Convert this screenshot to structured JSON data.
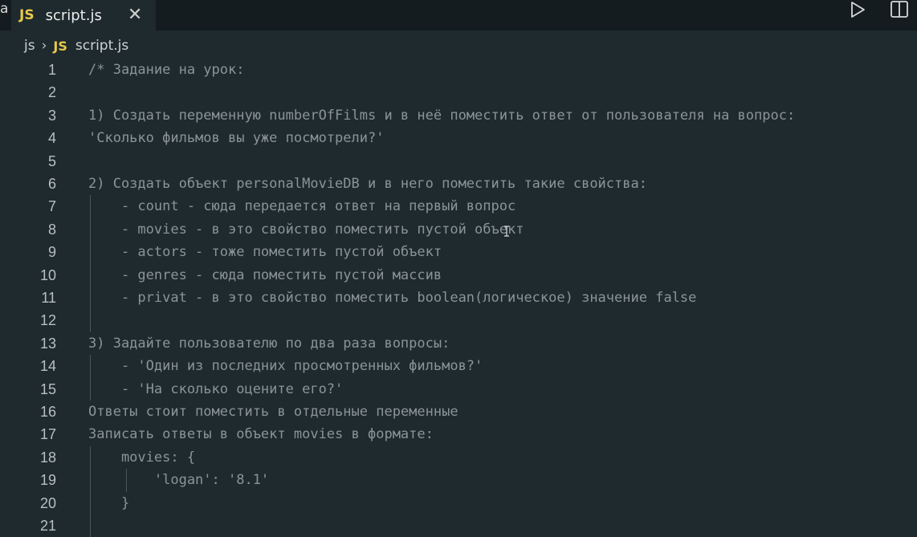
{
  "tabbar": {
    "left_stub": "a",
    "active_tab": {
      "badge": "JS",
      "name": "script.js",
      "close_glyph": "✕"
    },
    "actions": [
      "play-icon",
      "split-editor-icon"
    ]
  },
  "breadcrumb": {
    "folder": "js",
    "separator": "›",
    "badge": "JS",
    "file": "script.js"
  },
  "editor": {
    "lines": [
      {
        "n": "1",
        "text": "/* Задание на урок:"
      },
      {
        "n": "2",
        "text": ""
      },
      {
        "n": "3",
        "text": "1) Создать переменную numberOfFilms и в неё поместить ответ от пользователя на вопрос:"
      },
      {
        "n": "4",
        "text": "'Сколько фильмов вы уже посмотрели?'"
      },
      {
        "n": "5",
        "text": ""
      },
      {
        "n": "6",
        "text": "2) Создать объект personalMovieDB и в него поместить такие свойства:"
      },
      {
        "n": "7",
        "text": "    - count - сюда передается ответ на первый вопрос"
      },
      {
        "n": "8",
        "text": "    - movies - в это свойство поместить пустой объект"
      },
      {
        "n": "9",
        "text": "    - actors - тоже поместить пустой объект"
      },
      {
        "n": "10",
        "text": "    - genres - сюда поместить пустой массив"
      },
      {
        "n": "11",
        "text": "    - privat - в это свойство поместить boolean(логическое) значение false"
      },
      {
        "n": "12",
        "text": ""
      },
      {
        "n": "13",
        "text": "3) Задайте пользователю по два раза вопросы:"
      },
      {
        "n": "14",
        "text": "    - 'Один из последних просмотренных фильмов?'"
      },
      {
        "n": "15",
        "text": "    - 'На сколько оцените его?'"
      },
      {
        "n": "16",
        "text": "Ответы стоит поместить в отдельные переменные"
      },
      {
        "n": "17",
        "text": "Записать ответы в объект movies в формате:"
      },
      {
        "n": "18",
        "text": "    movies: {"
      },
      {
        "n": "19",
        "text": "        'logan': '8.1'"
      },
      {
        "n": "20",
        "text": "    }"
      },
      {
        "n": "21",
        "text": ""
      }
    ]
  },
  "colors": {
    "background": "#1e2a2d",
    "comment_text": "#8b9496",
    "js_badge": "#e8c84a"
  }
}
